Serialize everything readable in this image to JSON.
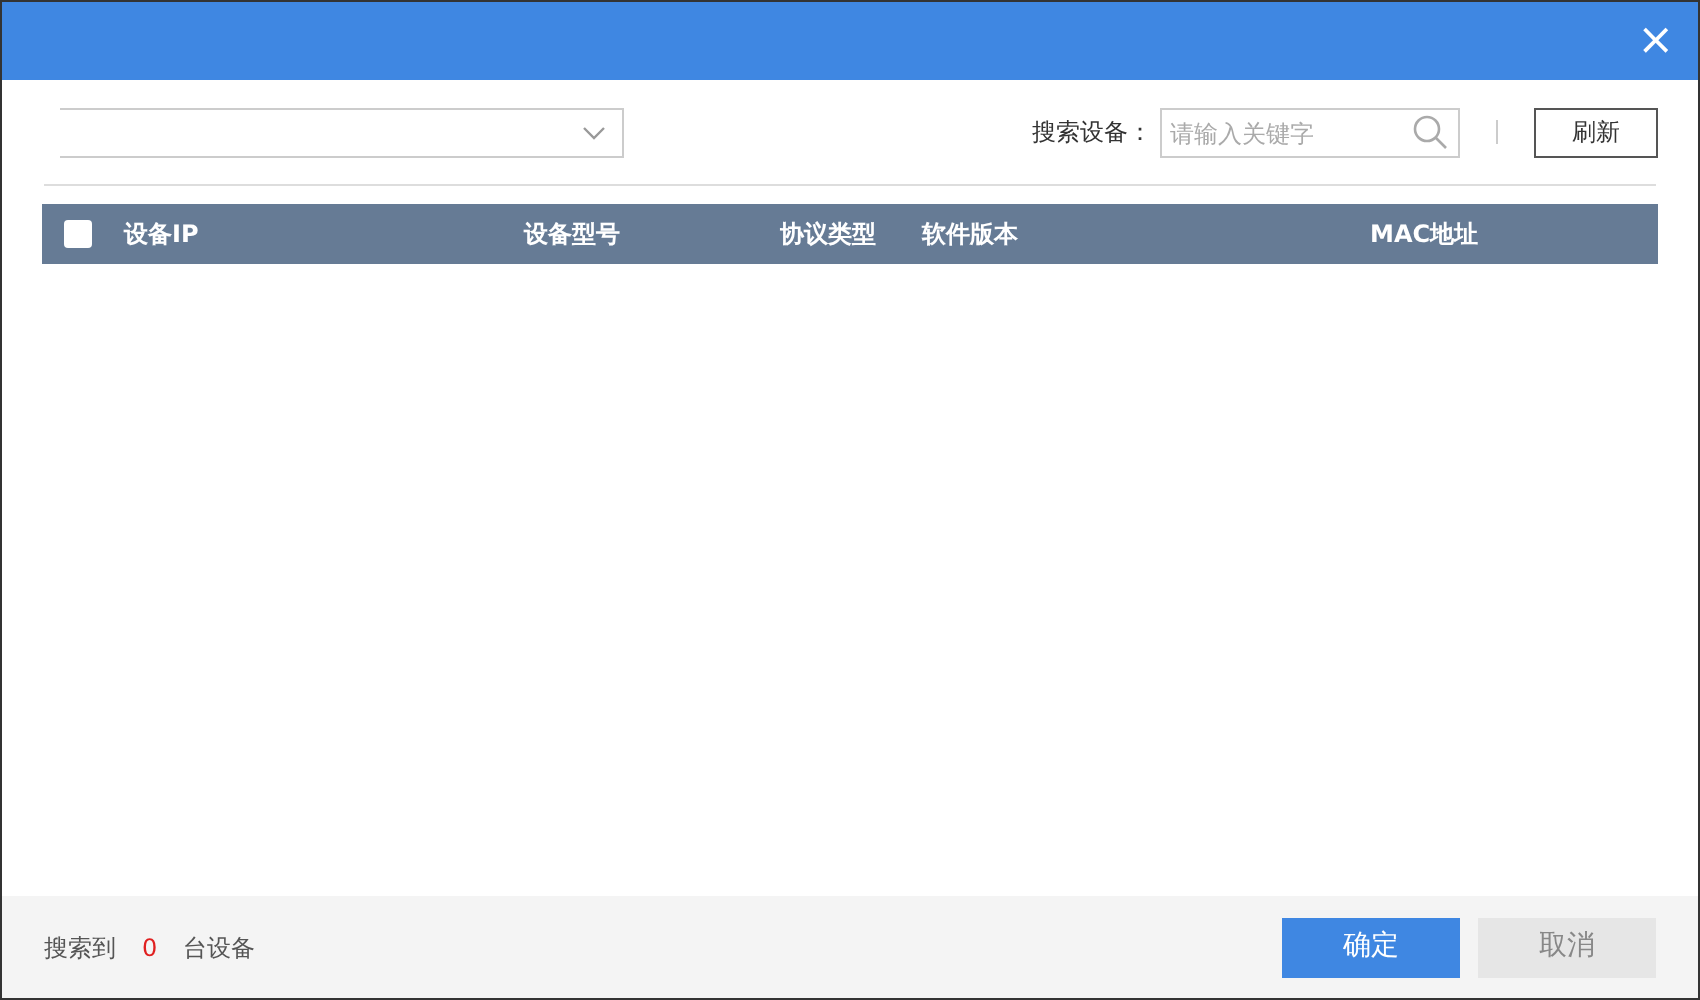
{
  "close_icon": "×",
  "toolbar": {
    "search_label": "搜索设备：",
    "search": {
      "placeholder": "请输入关键字"
    },
    "refresh_button": "刷新"
  },
  "table": {
    "select_all": {
      "checked": false
    },
    "columns": [
      "设备IP",
      "设备型号",
      "协议类型",
      "软件版本",
      "MAC地址"
    ]
  },
  "footer": {
    "prefix": "搜索到",
    "count": "0",
    "suffix": "台设备",
    "buttons": [
      {
        "label": "确定",
        "kind": "primary"
      },
      {
        "label": "取消",
        "kind": "secondary"
      }
    ]
  }
}
